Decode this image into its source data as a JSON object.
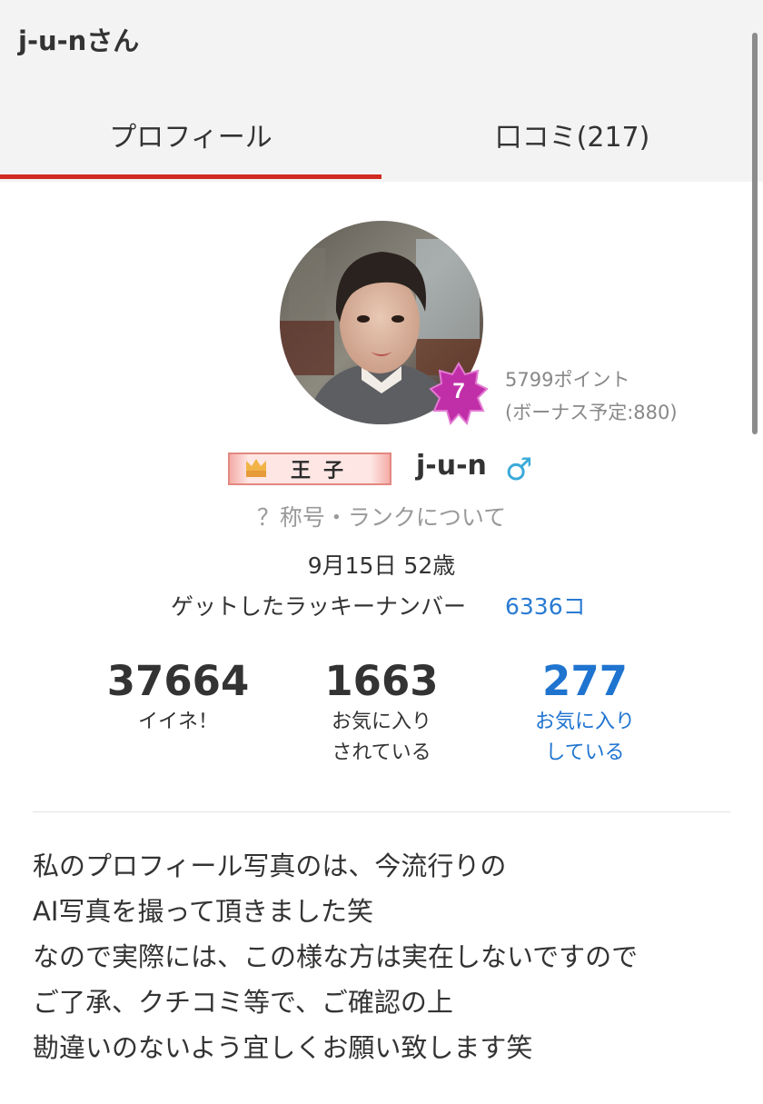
{
  "header": {
    "title": "j-u-nさん"
  },
  "tabs": [
    {
      "label": "プロフィール",
      "active": true
    },
    {
      "label": "口コミ(217)",
      "active": false
    }
  ],
  "profile": {
    "rank_level": "7",
    "points": "5799ポイント",
    "bonus": "(ボーナス予定:880)",
    "title_badge": "王子",
    "username": "j-u-n",
    "gender_symbol": "♂",
    "rank_help_link": "？称号・ランクについて",
    "birthday": "9月15日 52歳",
    "lucky_number_label": "ゲットしたラッキーナンバー",
    "lucky_number_value": "6336コ"
  },
  "stats": {
    "likes": {
      "value": "37664",
      "label": "イイネ！"
    },
    "favorited": {
      "value": "1663",
      "label_line1": "お気に入り",
      "label_line2": "されている"
    },
    "favoriting": {
      "value": "277",
      "label_line1": "お気に入り",
      "label_line2": "している"
    }
  },
  "bio": {
    "lines": [
      "私のプロフィール写真のは、今流行りの",
      "AI写真を撮って頂きました笑",
      "なので実際には、この様な方は実在しないですので",
      "ご了承、クチコミ等で、ご確認の上",
      "勘違いのないよう宜しくお願い致します笑"
    ]
  },
  "colors": {
    "accent_red": "#d12a22",
    "link_blue": "#1f74d0",
    "gender_blue": "#3aaad8",
    "rank_badge_purple": "#c02fa8"
  },
  "icons": {
    "avatar": "profile-photo",
    "rank_badge": "star-badge-icon",
    "title_badge": "crown-icon",
    "gender": "male-icon"
  }
}
